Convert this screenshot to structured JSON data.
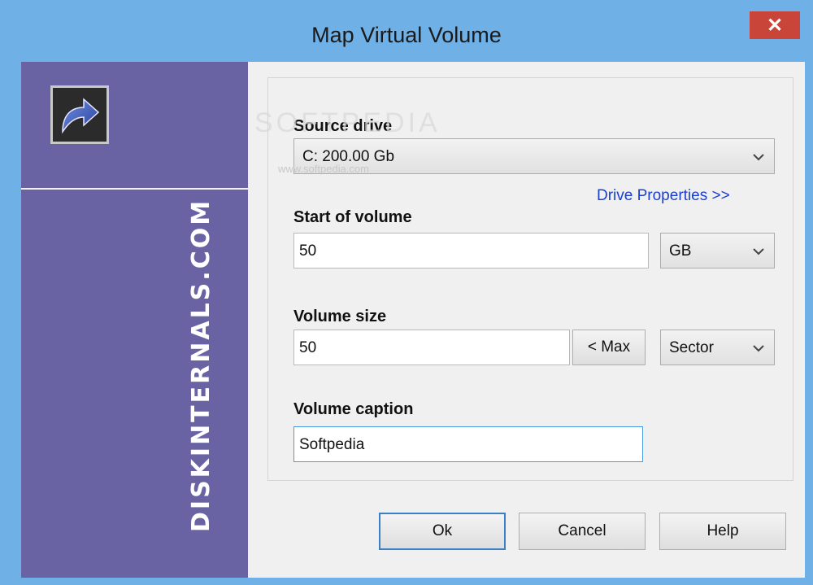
{
  "window": {
    "title": "Map Virtual Volume",
    "close_glyph": "✕"
  },
  "sidebar": {
    "brand_text": "DISKINTERNALS.COM",
    "icon": "shortcut-arrow-icon",
    "color": "#6a63a3"
  },
  "watermark": {
    "text": "SOFTPEDIA",
    "subtext": "www.softpedia.com"
  },
  "form": {
    "source_drive": {
      "label": "Source drive",
      "value": "C: 200.00 Gb"
    },
    "drive_properties_link": "Drive Properties >>",
    "start_of_volume": {
      "label": "Start of volume",
      "value": "50",
      "unit": "GB"
    },
    "volume_size": {
      "label": "Volume size",
      "value": "50",
      "max_button": "< Max",
      "unit": "Sector"
    },
    "volume_caption": {
      "label": "Volume caption",
      "value": "Softpedia"
    }
  },
  "buttons": {
    "ok": "Ok",
    "cancel": "Cancel",
    "help": "Help"
  },
  "colors": {
    "titlebar": "#6fb0e6",
    "close": "#c9453a",
    "link": "#1a3fcf",
    "focus": "#4a9be0"
  }
}
